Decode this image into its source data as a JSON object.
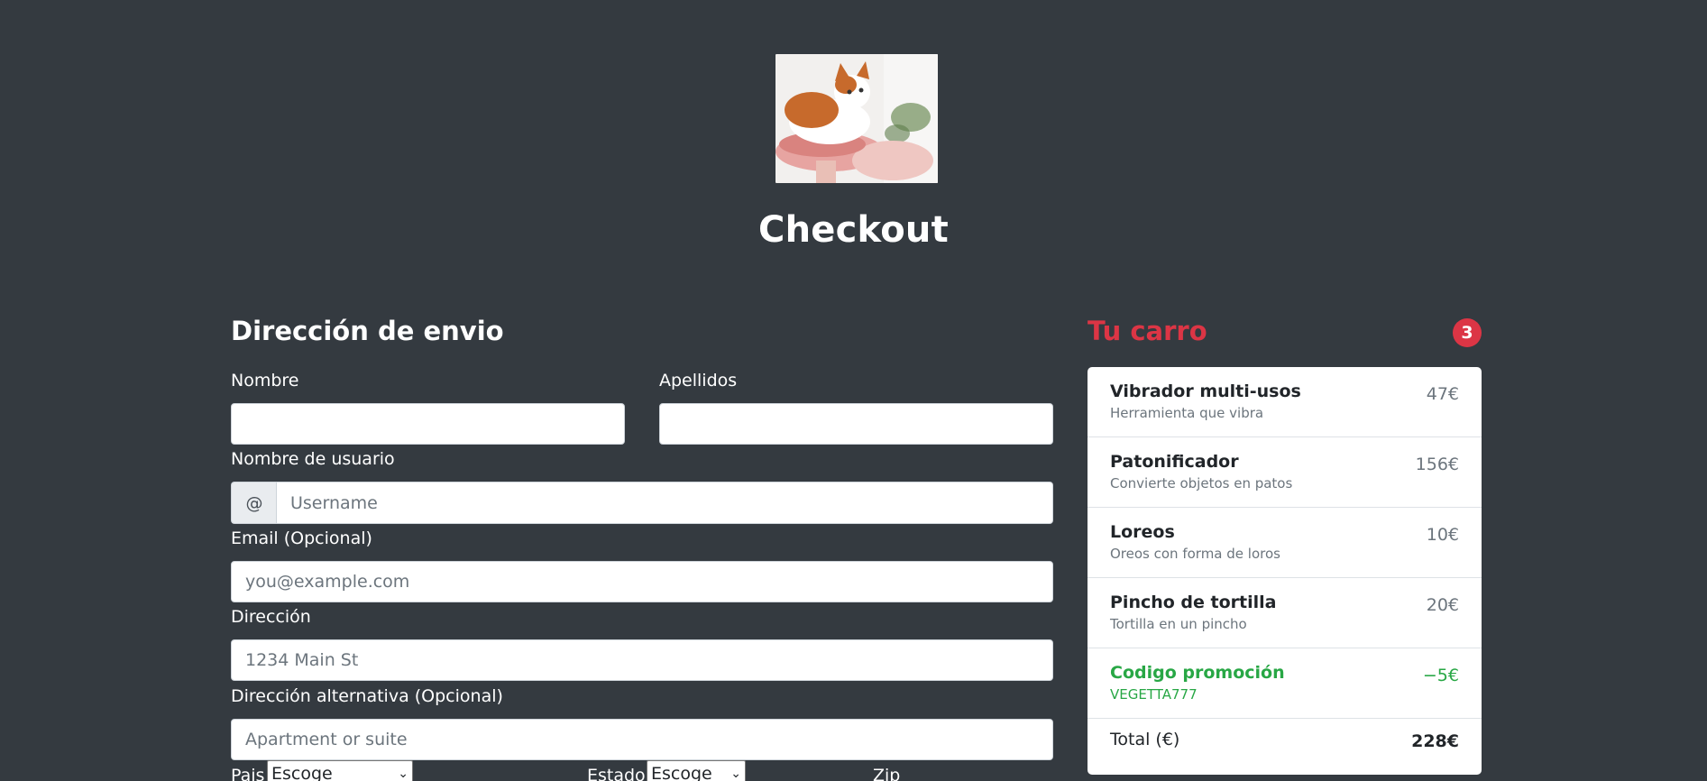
{
  "hero": {
    "image": "cat-photo"
  },
  "header": {
    "title": "Checkout"
  },
  "form": {
    "section_title": "Dirección de envio",
    "first_name_label": "Nombre",
    "last_name_label": "Apellidos",
    "username_label": "Nombre de usuario",
    "username_addon": "@",
    "username_placeholder": "Username",
    "email_label": "Email (Opcional)",
    "email_placeholder": "you@example.com",
    "address_label": "Dirección",
    "address_placeholder": "1234 Main St",
    "address2_label": "Dirección alternativa (Opcional)",
    "address2_placeholder": "Apartment or suite",
    "country_label": "Pais",
    "country_value": "Escoge",
    "state_label": "Estado",
    "state_value": "Escoge",
    "zip_label": "Zip"
  },
  "cart": {
    "title": "Tu carro",
    "count": "3",
    "items": [
      {
        "name": "Vibrador multi-usos",
        "desc": "Herramienta que vibra",
        "price": "47€"
      },
      {
        "name": "Patonificador",
        "desc": "Convierte objetos en patos",
        "price": "156€"
      },
      {
        "name": "Loreos",
        "desc": "Oreos con forma de loros",
        "price": "10€"
      },
      {
        "name": "Pincho de tortilla",
        "desc": "Tortilla en un pincho",
        "price": "20€"
      }
    ],
    "promo": {
      "name": "Codigo promoción",
      "code": "VEGETTA777",
      "price": "−5€"
    },
    "total_label": "Total (€)",
    "total_value": "228€"
  },
  "colors": {
    "background": "#343a40",
    "accent": "#dc3545",
    "promo": "#28a745"
  }
}
